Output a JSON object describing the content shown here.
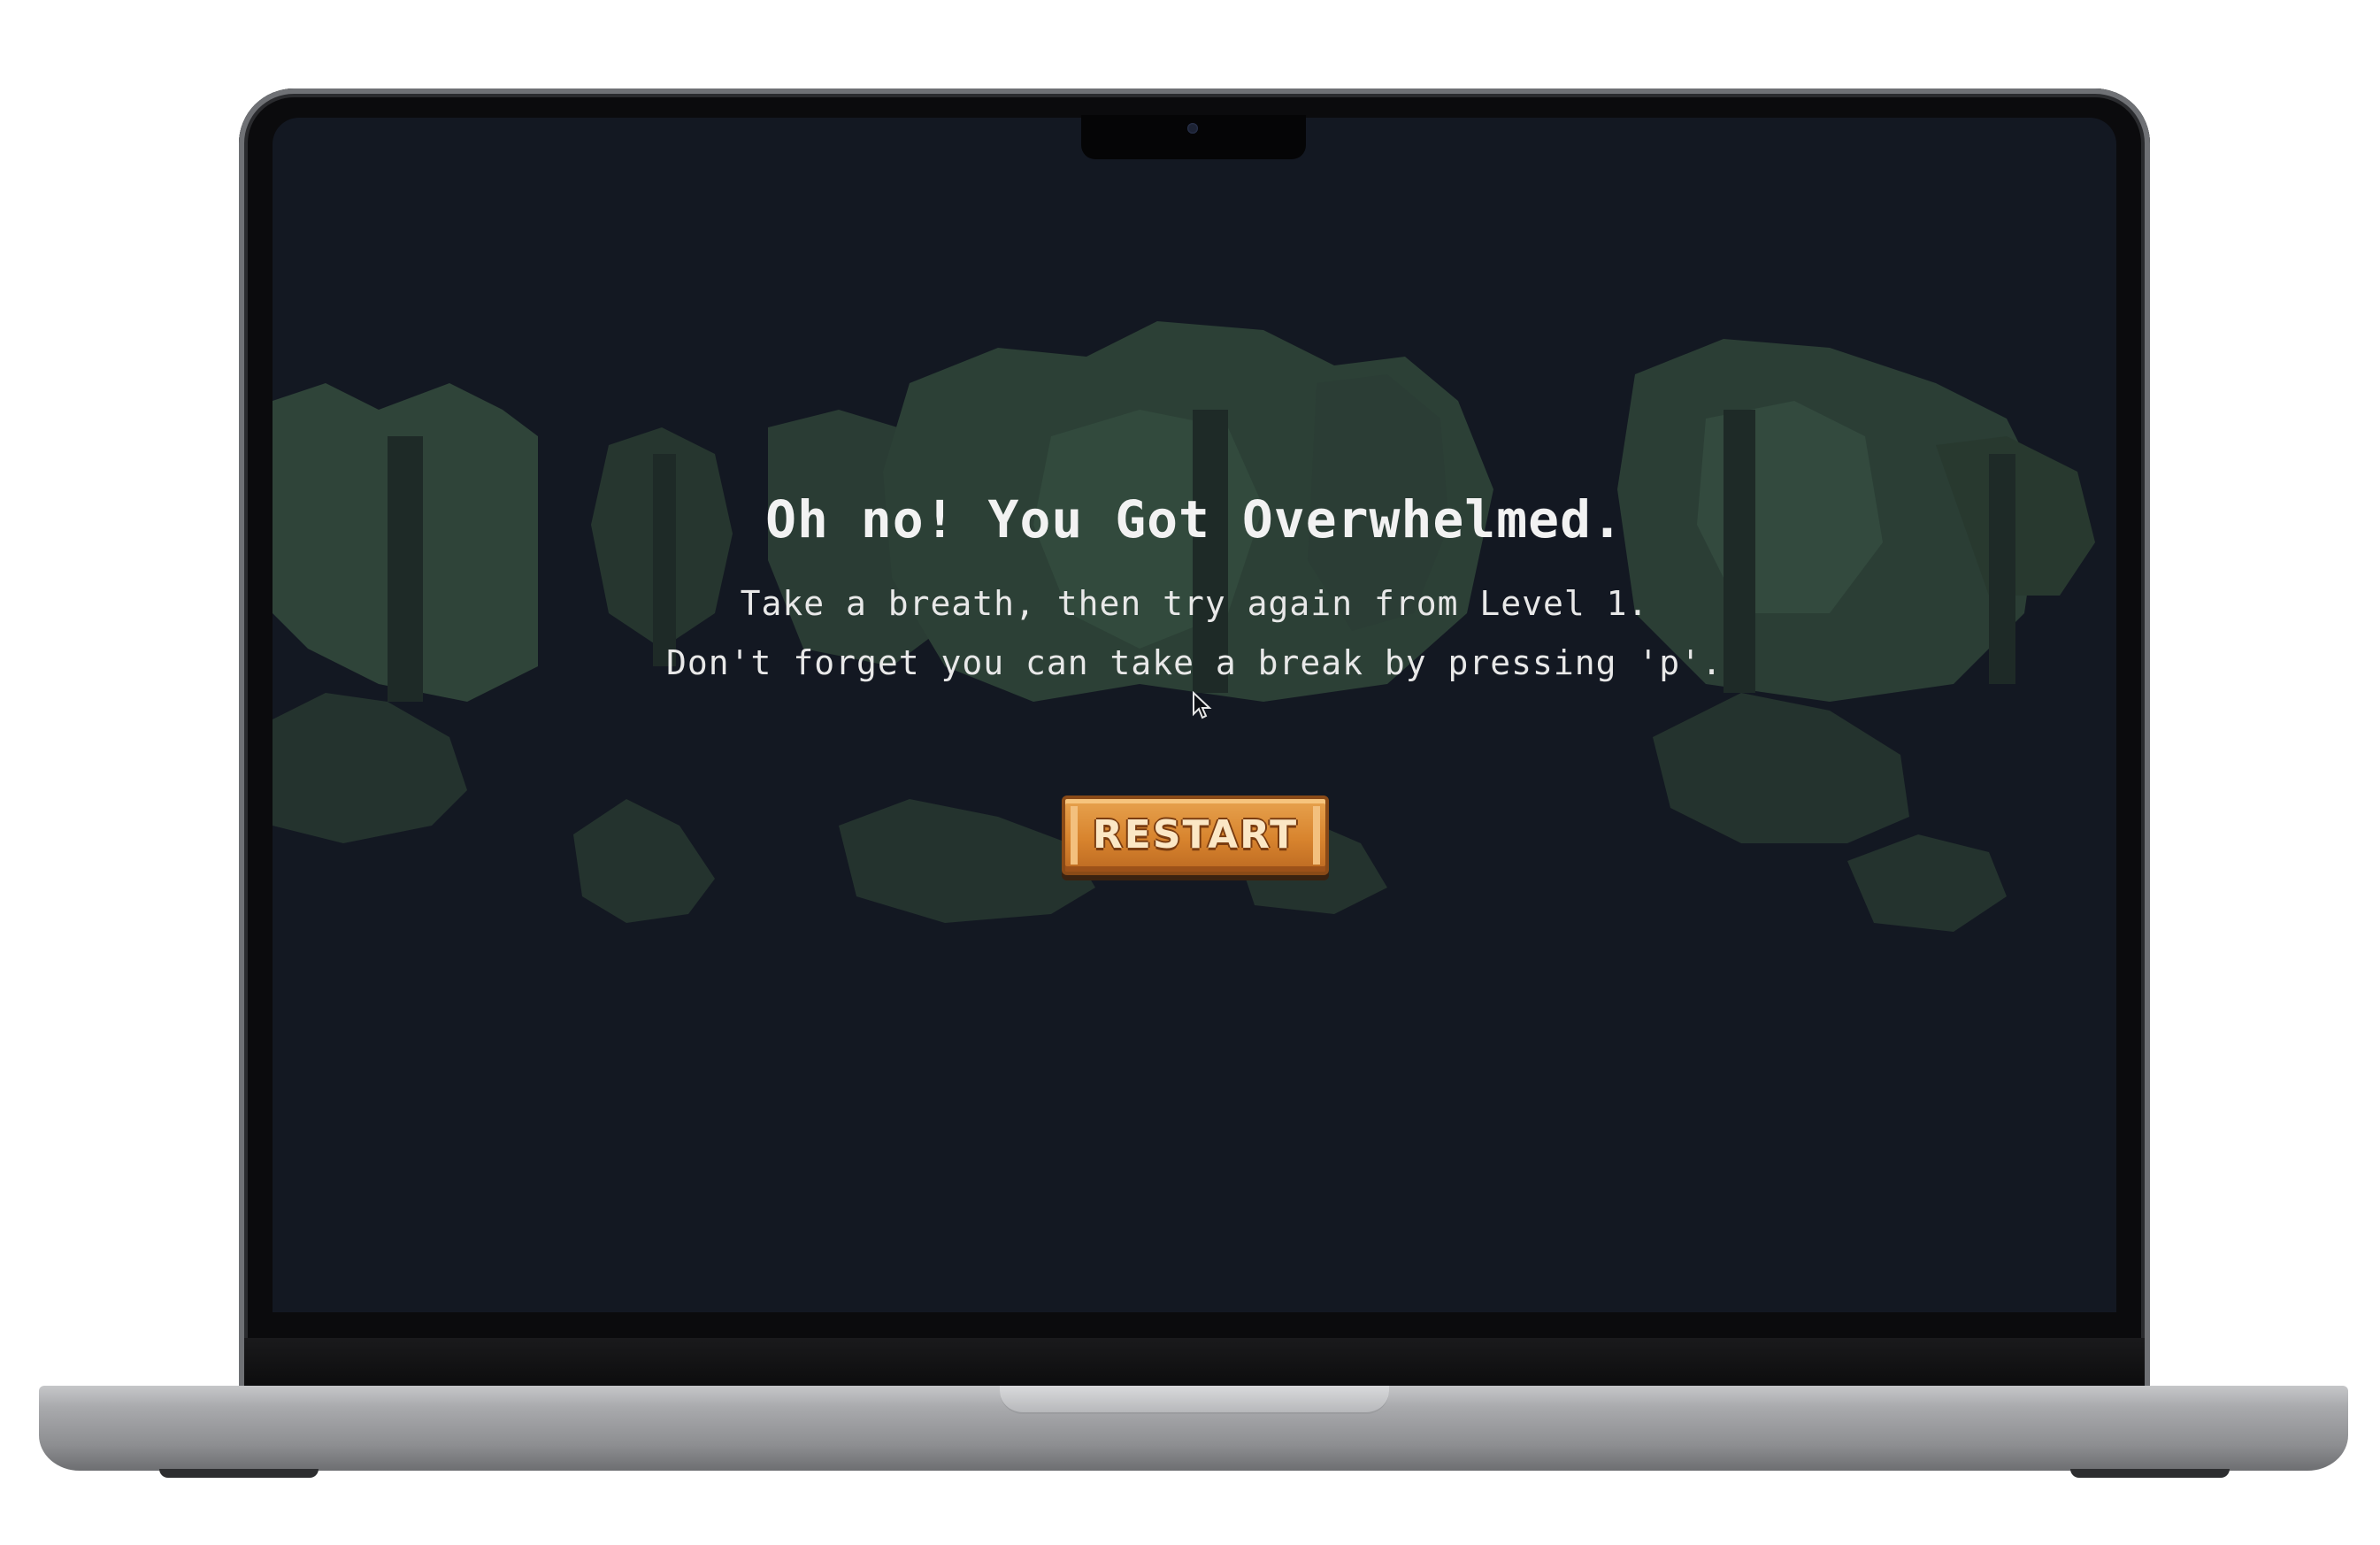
{
  "game": {
    "headline": "Oh no! You Got Overwhelmed.",
    "message_line_1": "Take a breath, then try again from Level 1.",
    "message_line_2": "Don't forget you can take a break by pressing 'p'.",
    "restart_label": "RESTART"
  },
  "colors": {
    "background": "#131822",
    "text": "#f2f2f2",
    "button": "#d8842e",
    "foliage": "#2e3f38"
  },
  "icons": [
    "mouse-cursor-icon",
    "camera-icon"
  ]
}
